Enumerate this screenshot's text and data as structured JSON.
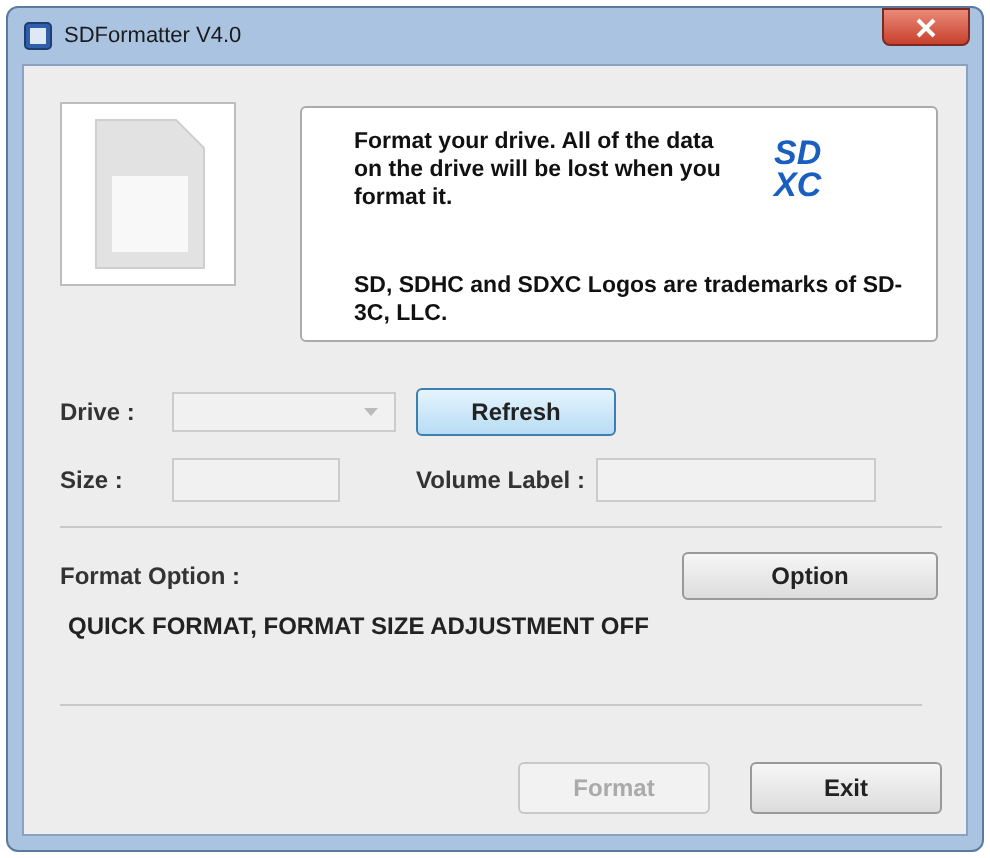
{
  "window": {
    "title": "SDFormatter V4.0"
  },
  "info": {
    "message": "Format your drive. All of the data on the drive will be lost when you format it.",
    "logo_top": "SD",
    "logo_bottom": "XC",
    "trademark": "SD, SDHC and SDXC Logos are trademarks of SD-3C, LLC."
  },
  "drive": {
    "label": "Drive :",
    "disabled": true,
    "refresh": "Refresh"
  },
  "size": {
    "label": "Size :"
  },
  "volume_label": {
    "label": "Volume Label :"
  },
  "format_option": {
    "label": "Format Option :",
    "button": "Option",
    "status": "QUICK FORMAT, FORMAT SIZE ADJUSTMENT OFF"
  },
  "buttons": [
    {
      "label": "Format",
      "disabled": true
    },
    {
      "label": "Exit",
      "disabled": false
    }
  ]
}
